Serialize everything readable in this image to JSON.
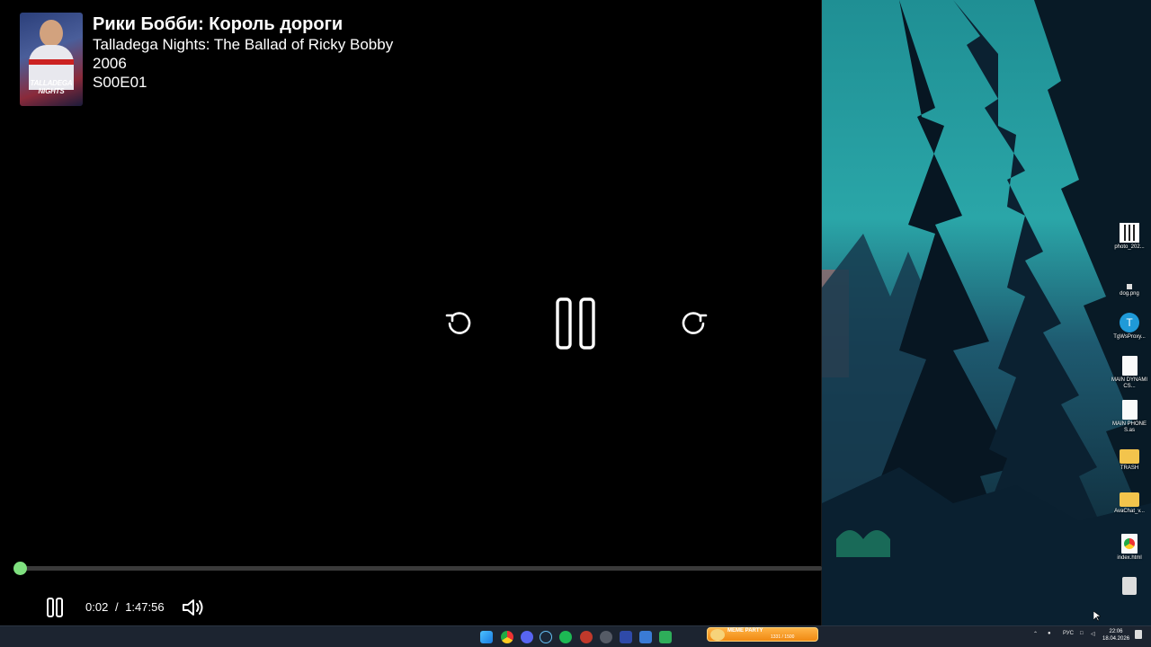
{
  "player": {
    "title_ru": "Рики Бобби: Король дороги",
    "title_en": "Talladega Nights: The Ballad of Ricky Bobby",
    "year": "2006",
    "episode": "S00E01",
    "poster_text": "TALLADEGA NIGHTS",
    "current_time": "0:02",
    "separator": "/",
    "duration": "1:47:56",
    "progress_fraction": 0.0003,
    "accent_color": "#6fdc72",
    "icons": {
      "rewind": "rewind-icon",
      "play_pause": "pause-icon",
      "forward": "forward-icon",
      "volume": "volume-icon"
    }
  },
  "desktop": {
    "icons": [
      {
        "label": "photo_202...",
        "icon": "qr-image-icon"
      },
      {
        "label": "dog.png",
        "icon": "image-file-icon"
      },
      {
        "label": "TgWsProxy...",
        "icon": "telegram-app-icon"
      },
      {
        "label": "MAIN DYNAMICS...",
        "icon": "document-icon"
      },
      {
        "label": "MAIN PHONES.as",
        "icon": "document-icon"
      },
      {
        "label": "TRASH",
        "icon": "folder-icon"
      },
      {
        "label": "AvaChat_v...",
        "icon": "folder-icon"
      },
      {
        "label": "index.html",
        "icon": "chrome-file-icon"
      },
      {
        "label": "",
        "icon": "app-icon"
      }
    ]
  },
  "taskbar": {
    "meme_widget": {
      "title": "MEME PARTY",
      "count": "1331 / 1500"
    },
    "tray_lang": "РУС",
    "time": "22:06",
    "date": "18.04.2026"
  }
}
